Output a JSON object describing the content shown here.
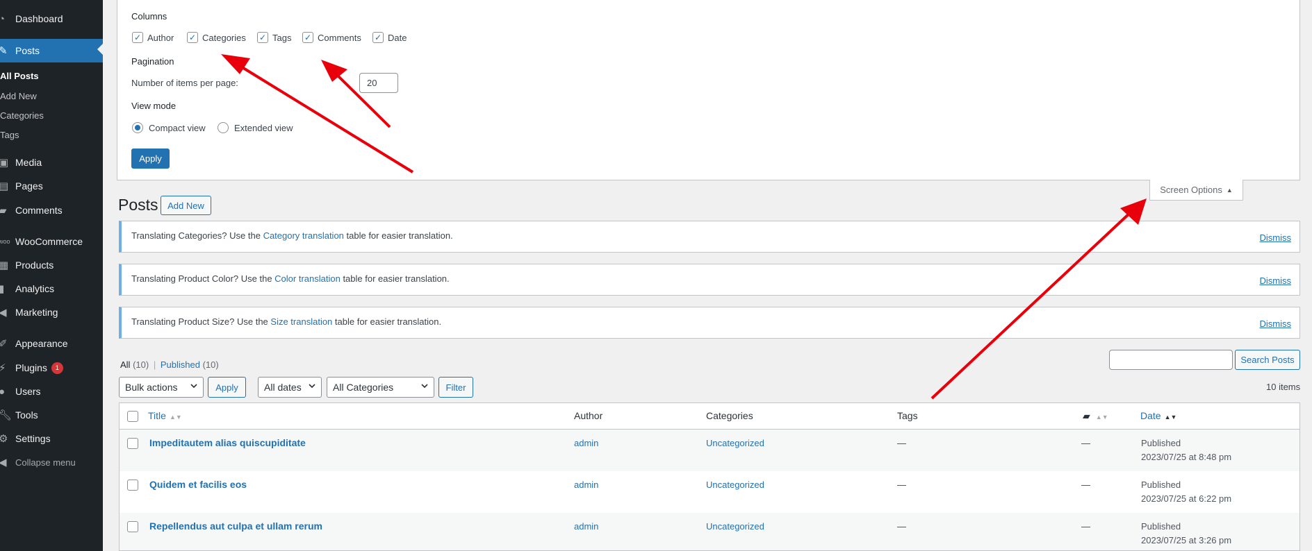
{
  "sidebar": {
    "dashboard": "Dashboard",
    "posts": "Posts",
    "posts_sub": [
      "All Posts",
      "Add New",
      "Categories",
      "Tags"
    ],
    "media": "Media",
    "pages": "Pages",
    "comments": "Comments",
    "woocommerce": "WooCommerce",
    "products": "Products",
    "analytics": "Analytics",
    "marketing": "Marketing",
    "appearance": "Appearance",
    "plugins": "Plugins",
    "plugins_badge": "1",
    "users": "Users",
    "tools": "Tools",
    "settings": "Settings",
    "collapse": "Collapse menu"
  },
  "screen_options": {
    "columns_heading": "Columns",
    "columns": [
      {
        "label": "Author",
        "checked": true
      },
      {
        "label": "Categories",
        "checked": true
      },
      {
        "label": "Tags",
        "checked": true
      },
      {
        "label": "Comments",
        "checked": true
      },
      {
        "label": "Date",
        "checked": true
      }
    ],
    "pagination_heading": "Pagination",
    "per_page_label": "Number of items per page:",
    "per_page_value": "20",
    "view_mode_heading": "View mode",
    "compact_view": "Compact view",
    "extended_view": "Extended view",
    "apply": "Apply",
    "tab_label": "Screen Options"
  },
  "page": {
    "title": "Posts",
    "add_new": "Add New"
  },
  "notices": [
    {
      "before": "Translating Categories? Use the ",
      "link": "Category translation",
      "after": " table for easier translation.",
      "dismiss": "Dismiss"
    },
    {
      "before": "Translating Product Color? Use the ",
      "link": "Color translation",
      "after": " table for easier translation.",
      "dismiss": "Dismiss"
    },
    {
      "before": "Translating Product Size? Use the ",
      "link": "Size translation",
      "after": " table for easier translation.",
      "dismiss": "Dismiss"
    }
  ],
  "filters": {
    "all": "All",
    "all_count": "(10)",
    "sep": "|",
    "published": "Published",
    "published_count": "(10)",
    "search_button": "Search Posts",
    "bulk_actions": "Bulk actions",
    "apply": "Apply",
    "all_dates": "All dates",
    "all_categories": "All Categories",
    "filter": "Filter",
    "items_count": "10 items"
  },
  "table": {
    "headers": {
      "title": "Title",
      "author": "Author",
      "categories": "Categories",
      "tags": "Tags",
      "date": "Date"
    },
    "rows": [
      {
        "title": "Impeditautem alias quiscupiditate",
        "author": "admin",
        "category": "Uncategorized",
        "tags": "—",
        "comments": "—",
        "status": "Published",
        "date": "2023/07/25 at 8:48 pm"
      },
      {
        "title": "Quidem et facilis eos",
        "author": "admin",
        "category": "Uncategorized",
        "tags": "—",
        "comments": "—",
        "status": "Published",
        "date": "2023/07/25 at 6:22 pm"
      },
      {
        "title": "Repellendus aut culpa et ullam rerum",
        "author": "admin",
        "category": "Uncategorized",
        "tags": "—",
        "comments": "—",
        "status": "Published",
        "date": "2023/07/25 at 3:26 pm"
      }
    ]
  },
  "colors": {
    "accent": "#2271b1",
    "sidebar_bg": "#1d2327",
    "annotation_arrow": "#e8000b",
    "notice_border": "#72aee6"
  }
}
